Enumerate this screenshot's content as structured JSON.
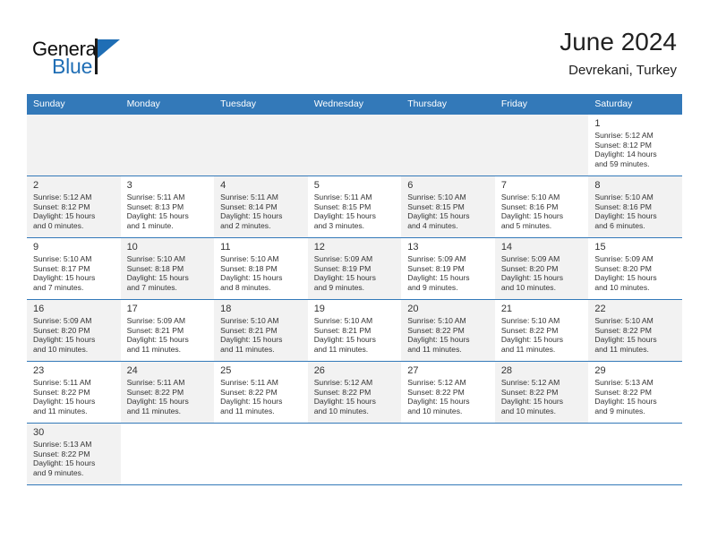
{
  "brand": {
    "name_top": "General",
    "name_bottom": "Blue",
    "accent_color": "#1f6eb5"
  },
  "header": {
    "title": "June 2024",
    "subtitle": "Devrekani, Turkey"
  },
  "calendar": {
    "header_bg": "#3379b9",
    "header_text_color": "#ffffff",
    "shaded_cell_bg": "#f2f2f2",
    "weekday_headers": [
      "Sunday",
      "Monday",
      "Tuesday",
      "Wednesday",
      "Thursday",
      "Friday",
      "Saturday"
    ],
    "weeks": [
      [
        {
          "day": "",
          "detail": "",
          "shaded": true,
          "empty": true
        },
        {
          "day": "",
          "detail": "",
          "shaded": true,
          "empty": true
        },
        {
          "day": "",
          "detail": "",
          "shaded": true,
          "empty": true
        },
        {
          "day": "",
          "detail": "",
          "shaded": true,
          "empty": true
        },
        {
          "day": "",
          "detail": "",
          "shaded": true,
          "empty": true
        },
        {
          "day": "",
          "detail": "",
          "shaded": true,
          "empty": true
        },
        {
          "day": "1",
          "detail": "Sunrise: 5:12 AM\nSunset: 8:12 PM\nDaylight: 14 hours\nand 59 minutes.",
          "shaded": false,
          "empty": false
        }
      ],
      [
        {
          "day": "2",
          "detail": "Sunrise: 5:12 AM\nSunset: 8:12 PM\nDaylight: 15 hours\nand 0 minutes.",
          "shaded": true,
          "empty": false
        },
        {
          "day": "3",
          "detail": "Sunrise: 5:11 AM\nSunset: 8:13 PM\nDaylight: 15 hours\nand 1 minute.",
          "shaded": false,
          "empty": false
        },
        {
          "day": "4",
          "detail": "Sunrise: 5:11 AM\nSunset: 8:14 PM\nDaylight: 15 hours\nand 2 minutes.",
          "shaded": true,
          "empty": false
        },
        {
          "day": "5",
          "detail": "Sunrise: 5:11 AM\nSunset: 8:15 PM\nDaylight: 15 hours\nand 3 minutes.",
          "shaded": false,
          "empty": false
        },
        {
          "day": "6",
          "detail": "Sunrise: 5:10 AM\nSunset: 8:15 PM\nDaylight: 15 hours\nand 4 minutes.",
          "shaded": true,
          "empty": false
        },
        {
          "day": "7",
          "detail": "Sunrise: 5:10 AM\nSunset: 8:16 PM\nDaylight: 15 hours\nand 5 minutes.",
          "shaded": false,
          "empty": false
        },
        {
          "day": "8",
          "detail": "Sunrise: 5:10 AM\nSunset: 8:16 PM\nDaylight: 15 hours\nand 6 minutes.",
          "shaded": true,
          "empty": false
        }
      ],
      [
        {
          "day": "9",
          "detail": "Sunrise: 5:10 AM\nSunset: 8:17 PM\nDaylight: 15 hours\nand 7 minutes.",
          "shaded": false,
          "empty": false
        },
        {
          "day": "10",
          "detail": "Sunrise: 5:10 AM\nSunset: 8:18 PM\nDaylight: 15 hours\nand 7 minutes.",
          "shaded": true,
          "empty": false
        },
        {
          "day": "11",
          "detail": "Sunrise: 5:10 AM\nSunset: 8:18 PM\nDaylight: 15 hours\nand 8 minutes.",
          "shaded": false,
          "empty": false
        },
        {
          "day": "12",
          "detail": "Sunrise: 5:09 AM\nSunset: 8:19 PM\nDaylight: 15 hours\nand 9 minutes.",
          "shaded": true,
          "empty": false
        },
        {
          "day": "13",
          "detail": "Sunrise: 5:09 AM\nSunset: 8:19 PM\nDaylight: 15 hours\nand 9 minutes.",
          "shaded": false,
          "empty": false
        },
        {
          "day": "14",
          "detail": "Sunrise: 5:09 AM\nSunset: 8:20 PM\nDaylight: 15 hours\nand 10 minutes.",
          "shaded": true,
          "empty": false
        },
        {
          "day": "15",
          "detail": "Sunrise: 5:09 AM\nSunset: 8:20 PM\nDaylight: 15 hours\nand 10 minutes.",
          "shaded": false,
          "empty": false
        }
      ],
      [
        {
          "day": "16",
          "detail": "Sunrise: 5:09 AM\nSunset: 8:20 PM\nDaylight: 15 hours\nand 10 minutes.",
          "shaded": true,
          "empty": false
        },
        {
          "day": "17",
          "detail": "Sunrise: 5:09 AM\nSunset: 8:21 PM\nDaylight: 15 hours\nand 11 minutes.",
          "shaded": false,
          "empty": false
        },
        {
          "day": "18",
          "detail": "Sunrise: 5:10 AM\nSunset: 8:21 PM\nDaylight: 15 hours\nand 11 minutes.",
          "shaded": true,
          "empty": false
        },
        {
          "day": "19",
          "detail": "Sunrise: 5:10 AM\nSunset: 8:21 PM\nDaylight: 15 hours\nand 11 minutes.",
          "shaded": false,
          "empty": false
        },
        {
          "day": "20",
          "detail": "Sunrise: 5:10 AM\nSunset: 8:22 PM\nDaylight: 15 hours\nand 11 minutes.",
          "shaded": true,
          "empty": false
        },
        {
          "day": "21",
          "detail": "Sunrise: 5:10 AM\nSunset: 8:22 PM\nDaylight: 15 hours\nand 11 minutes.",
          "shaded": false,
          "empty": false
        },
        {
          "day": "22",
          "detail": "Sunrise: 5:10 AM\nSunset: 8:22 PM\nDaylight: 15 hours\nand 11 minutes.",
          "shaded": true,
          "empty": false
        }
      ],
      [
        {
          "day": "23",
          "detail": "Sunrise: 5:11 AM\nSunset: 8:22 PM\nDaylight: 15 hours\nand 11 minutes.",
          "shaded": false,
          "empty": false
        },
        {
          "day": "24",
          "detail": "Sunrise: 5:11 AM\nSunset: 8:22 PM\nDaylight: 15 hours\nand 11 minutes.",
          "shaded": true,
          "empty": false
        },
        {
          "day": "25",
          "detail": "Sunrise: 5:11 AM\nSunset: 8:22 PM\nDaylight: 15 hours\nand 11 minutes.",
          "shaded": false,
          "empty": false
        },
        {
          "day": "26",
          "detail": "Sunrise: 5:12 AM\nSunset: 8:22 PM\nDaylight: 15 hours\nand 10 minutes.",
          "shaded": true,
          "empty": false
        },
        {
          "day": "27",
          "detail": "Sunrise: 5:12 AM\nSunset: 8:22 PM\nDaylight: 15 hours\nand 10 minutes.",
          "shaded": false,
          "empty": false
        },
        {
          "day": "28",
          "detail": "Sunrise: 5:12 AM\nSunset: 8:22 PM\nDaylight: 15 hours\nand 10 minutes.",
          "shaded": true,
          "empty": false
        },
        {
          "day": "29",
          "detail": "Sunrise: 5:13 AM\nSunset: 8:22 PM\nDaylight: 15 hours\nand 9 minutes.",
          "shaded": false,
          "empty": false
        }
      ],
      [
        {
          "day": "30",
          "detail": "Sunrise: 5:13 AM\nSunset: 8:22 PM\nDaylight: 15 hours\nand 9 minutes.",
          "shaded": true,
          "empty": false
        },
        {
          "day": "",
          "detail": "",
          "shaded": false,
          "empty": true
        },
        {
          "day": "",
          "detail": "",
          "shaded": false,
          "empty": true
        },
        {
          "day": "",
          "detail": "",
          "shaded": false,
          "empty": true
        },
        {
          "day": "",
          "detail": "",
          "shaded": false,
          "empty": true
        },
        {
          "day": "",
          "detail": "",
          "shaded": false,
          "empty": true
        },
        {
          "day": "",
          "detail": "",
          "shaded": false,
          "empty": true
        }
      ]
    ]
  }
}
